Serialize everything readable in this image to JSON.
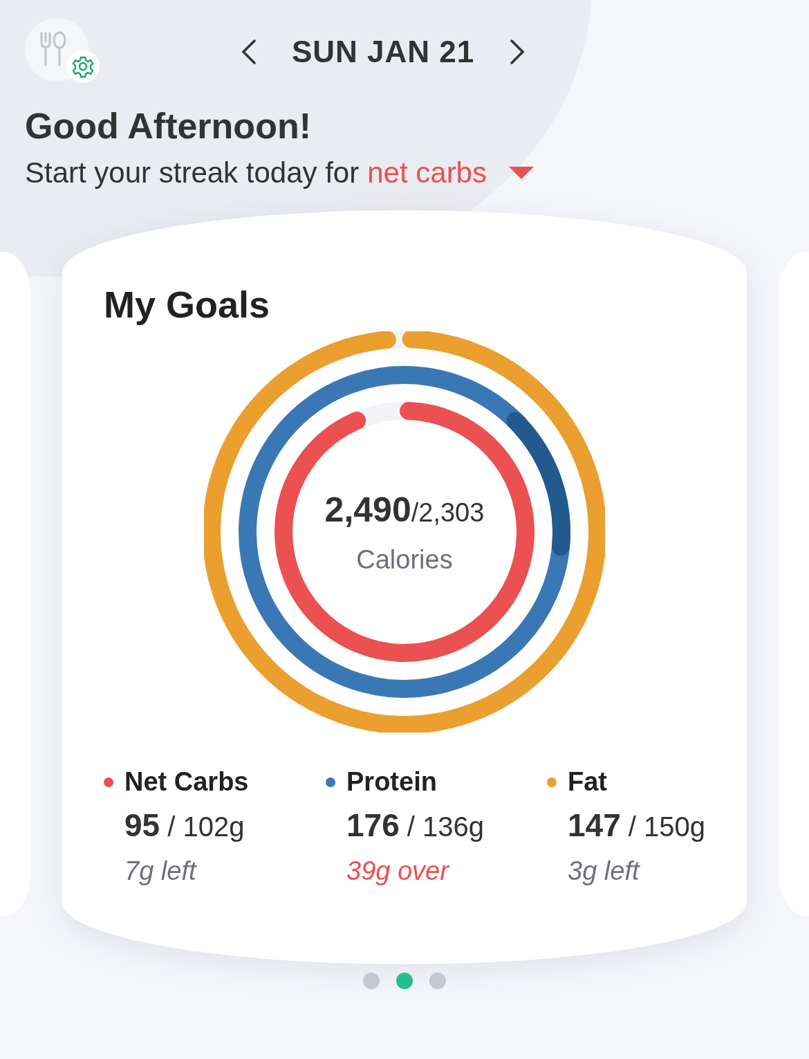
{
  "date_nav": {
    "date": "SUN JAN 21"
  },
  "greeting": "Good Afternoon!",
  "streak": {
    "prefix": "Start your streak today for",
    "target": "net carbs"
  },
  "card": {
    "title": "My Goals",
    "calories": {
      "consumed": "2,490",
      "goal": "/2,303",
      "label": "Calories"
    },
    "macros": [
      {
        "name": "Net Carbs",
        "value": "95",
        "goal": "/ 102g",
        "remaining": "7g left",
        "kind": "left",
        "color": "#ea5150"
      },
      {
        "name": "Protein",
        "value": "176",
        "goal": "/ 136g",
        "remaining": "39g over",
        "kind": "over",
        "color": "#3a78b5"
      },
      {
        "name": "Fat",
        "value": "147",
        "goal": "/ 150g",
        "remaining": "3g left",
        "kind": "left",
        "color": "#eb9f2f"
      }
    ],
    "rings": [
      {
        "kind": "normal",
        "color": "#ea5150",
        "level": 0.93
      },
      {
        "kind": "over",
        "color": "#3a78b5",
        "level": 1
      },
      {
        "kind": "normal",
        "color": "#eb9f2f",
        "level": 0.98
      }
    ]
  },
  "pager": [
    {
      "selected": false
    },
    {
      "selected": true
    },
    {
      "selected": false
    }
  ]
}
